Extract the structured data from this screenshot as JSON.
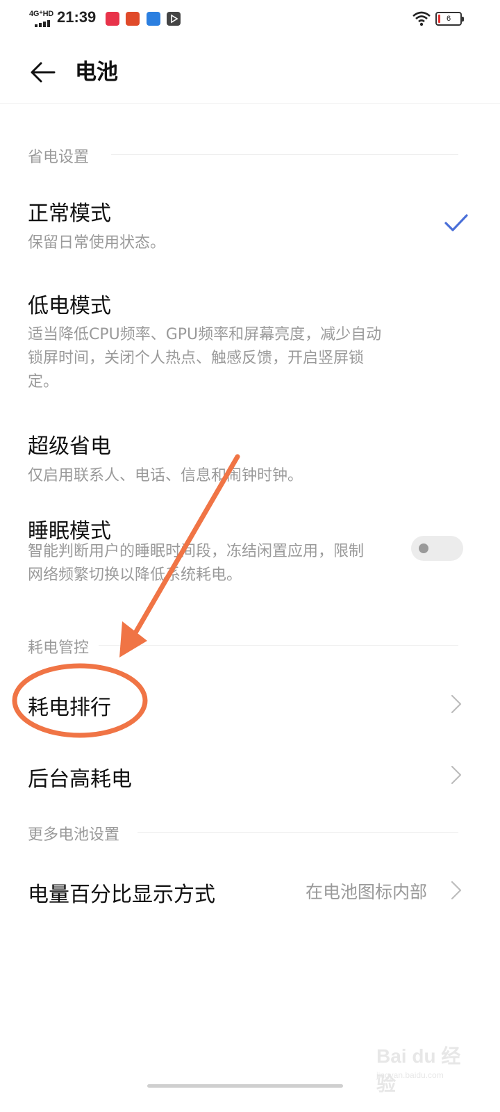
{
  "status_bar": {
    "network": "4G⁺HD",
    "time": "21:39",
    "battery_level": "6"
  },
  "header": {
    "title": "电池"
  },
  "sections": {
    "power_saving": "省电设置",
    "consumption": "耗电管控",
    "more": "更多电池设置"
  },
  "modes": {
    "normal": {
      "title": "正常模式",
      "desc": "保留日常使用状态。",
      "selected": true
    },
    "low": {
      "title": "低电模式",
      "desc_lines": [
        "适当降低CPU频率、GPU频率和屏幕亮度，减少自动",
        "锁屏时间，关闭个人热点、触感反馈，开启竖屏锁",
        "定。"
      ]
    },
    "super": {
      "title": "超级省电",
      "desc": "仅启用联系人、电话、信息和闹钟时钟。"
    },
    "sleep": {
      "title": "睡眠模式",
      "desc_lines": [
        "智能判断用户的睡眠时间段，冻结闲置应用，限制",
        "网络频繁切换以降低系统耗电。"
      ],
      "enabled": false
    }
  },
  "consumption": {
    "ranking": "耗电排行",
    "background": "后台高耗电"
  },
  "more": {
    "percent_display": "电量百分比显示方式",
    "percent_display_value": "在电池图标内部"
  },
  "watermark": {
    "brand": "Bai du 经验",
    "url": "jingyan.baidu.com"
  },
  "annotation_color": "#f07445",
  "accent_color": "#4a6fd8"
}
